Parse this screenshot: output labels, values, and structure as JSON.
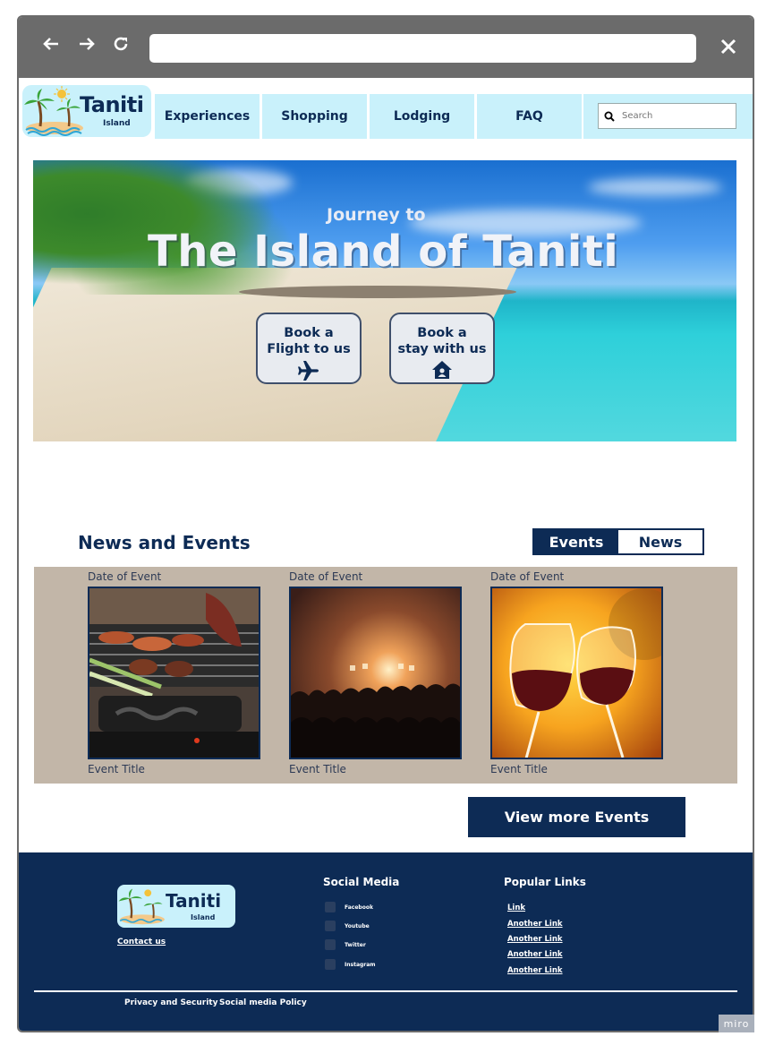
{
  "browser": {
    "back_icon": "arrow-left-icon",
    "forward_icon": "arrow-right-icon",
    "reload_icon": "reload-icon",
    "close_icon": "close-icon",
    "url": ""
  },
  "header": {
    "logo_title": "Taniti",
    "logo_subtitle": "Island",
    "menu": [
      "Experiences",
      "Shopping",
      "Lodging",
      "FAQ"
    ],
    "search_placeholder": "Search"
  },
  "hero": {
    "subtitle": "Journey to",
    "title": "The Island of Taniti",
    "cta_flight": {
      "line1": "Book a",
      "line2": "Flight to us",
      "icon": "airplane-icon"
    },
    "cta_stay": {
      "line1": "Book a",
      "line2": "stay with us",
      "icon": "house-icon"
    }
  },
  "news": {
    "heading": "News and Events",
    "toggle": {
      "active": "Events",
      "inactive": "News"
    },
    "events": [
      {
        "date": "Date of Event",
        "title": "Event Title",
        "image": "barbecue-grill-photo"
      },
      {
        "date": "Date of Event",
        "title": "Event Title",
        "image": "concert-crowd-photo"
      },
      {
        "date": "Date of Event",
        "title": "Event Title",
        "image": "wine-glasses-toast-photo"
      }
    ],
    "more_button": "View more Events"
  },
  "footer": {
    "logo_title": "Taniti",
    "logo_subtitle": "Island",
    "contact": "Contact us",
    "social_heading": "Social Media",
    "social": [
      "Facebook",
      "Youtube",
      "Twitter",
      "Instagram"
    ],
    "links_heading": "Popular Links",
    "links": [
      "Link",
      "Another Link",
      "Another Link",
      "Another Link",
      "Another Link"
    ],
    "privacy": "Privacy and Security",
    "policy": "Social media Policy"
  },
  "watermark": "miro",
  "colors": {
    "navy": "#0d2b55",
    "light_cyan": "#c9f1fb",
    "chrome_gray": "#6b6b6b",
    "events_bg": "#c2b6a8"
  }
}
